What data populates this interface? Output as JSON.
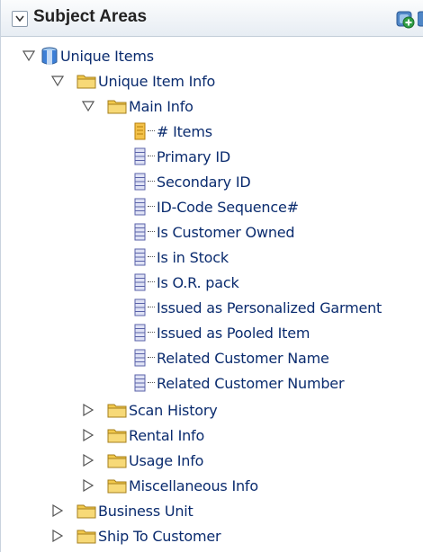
{
  "panel": {
    "title": "Subject Areas"
  },
  "tree": {
    "root": {
      "label": "Unique Items",
      "expanded": true
    },
    "unique_item_info": {
      "label": "Unique Item Info",
      "expanded": true
    },
    "main_info": {
      "label": "Main Info",
      "expanded": true
    },
    "main_info_columns": [
      "# Items",
      "Primary ID",
      "Secondary ID",
      "ID-Code Sequence#",
      "Is Customer Owned",
      "Is in Stock",
      "Is O.R. pack",
      "Issued as Personalized Garment",
      "Issued as Pooled Item",
      "Related Customer Name",
      "Related Customer Number"
    ],
    "subfolders": [
      "Scan History",
      "Rental Info",
      "Usage Info",
      "Miscellaneous Info"
    ],
    "top_folders": [
      "Business Unit",
      "Ship To Customer"
    ]
  },
  "colors": {
    "link_text": "#0a2b6e",
    "folder": "#f2c94c",
    "column_icon": "#5a62a8",
    "measure_icon": "#e8a81c",
    "cube": "#3d7fd6"
  }
}
